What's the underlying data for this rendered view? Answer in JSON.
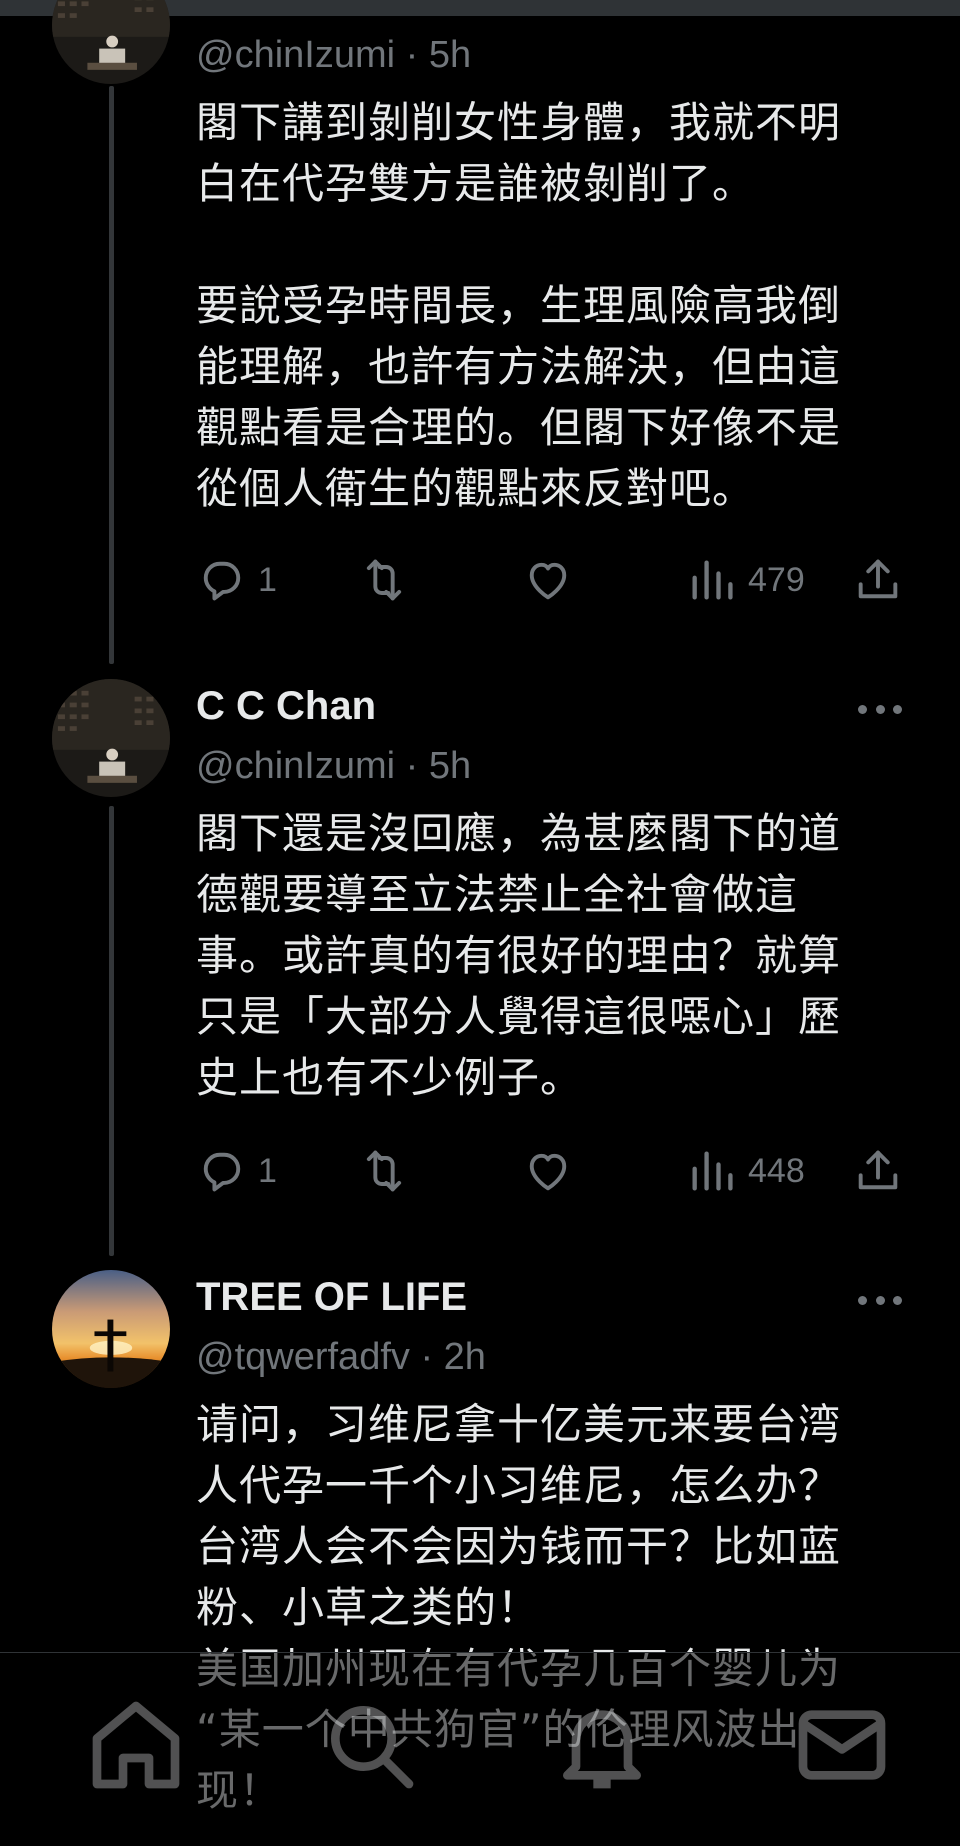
{
  "tweets": [
    {
      "handle": "@chinIzumi · 5h",
      "text": "閣下講到剝削女性身體，我就不明\n白在代孕雙方是誰被剝削了。\n\n要說受孕時間長，生理風險高我倒\n能理解，也許有方法解決，但由這\n觀點看是合理的。但閣下好像不是\n從個人衛生的觀點來反對吧。",
      "replies": "1",
      "views": "479"
    },
    {
      "name": "C C Chan",
      "handle": "@chinIzumi · 5h",
      "text": "閣下還是沒回應，為甚麼閣下的道\n德觀要導至立法禁止全社會做這\n事。或許真的有很好的理由？就算\n只是「大部分人覺得這很噁心」歷\n史上也有不少例子。",
      "replies": "1",
      "views": "448"
    },
    {
      "name": "TREE OF LIFE",
      "handle": "@tqwerfadfv · 2h",
      "text": "请问，习维尼拿十亿美元来要台湾\n人代孕一千个小习维尼，怎么办？\n台湾人会不会因为钱而干？比如蓝\n粉、小草之类的！\n美国加州现在有代孕几百个婴儿为\n“某一个中共狗官”的伦理风波出\n现！"
    }
  ],
  "icons": {
    "reply": "reply-icon",
    "repost": "repost-icon",
    "like": "like-icon",
    "views": "views-icon",
    "share": "share-icon",
    "more": "more-icon"
  },
  "bottom_nav": [
    "home-icon",
    "search-icon",
    "notifications-icon",
    "messages-icon"
  ],
  "colors": {
    "background": "#000000",
    "text": "#e7e9ea",
    "secondary": "#71767b",
    "thread_line": "#333639"
  }
}
